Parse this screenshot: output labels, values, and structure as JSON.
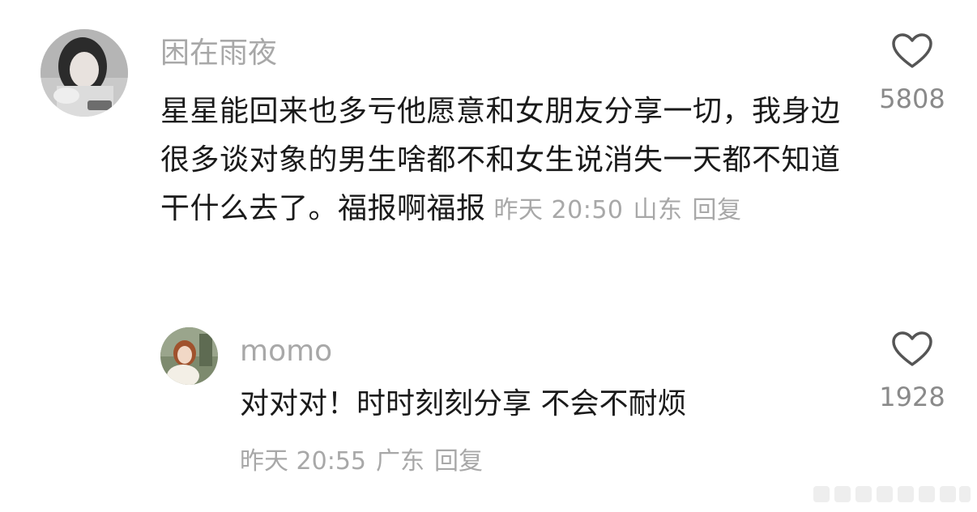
{
  "comments": [
    {
      "username": "困在雨夜",
      "avatar_icon": "user-avatar-photo",
      "text": "星星能回来也多亏他愿意和女朋友分享一切，我身边很多谈对象的男生啥都不和女生说消失一天都不知道干什么去了。福报啊福报",
      "time": "昨天 20:50",
      "location": "山东",
      "reply_label": "回复",
      "like_icon": "heart-outline-icon",
      "like_count": "5808"
    }
  ],
  "replies": [
    {
      "username": "momo",
      "avatar_icon": "user-avatar-photo",
      "text": "对对对！时时刻刻分享 不会不耐烦",
      "time": "昨天 20:55",
      "location": "广东",
      "reply_label": "回复",
      "like_icon": "heart-outline-icon",
      "like_count": "1928"
    }
  ],
  "colors": {
    "background": "#ffffff",
    "primary_text": "#1a1a1a",
    "secondary_text": "#a8a8a8",
    "like_count": "#8a8a8a",
    "icon_stroke": "#555555"
  }
}
